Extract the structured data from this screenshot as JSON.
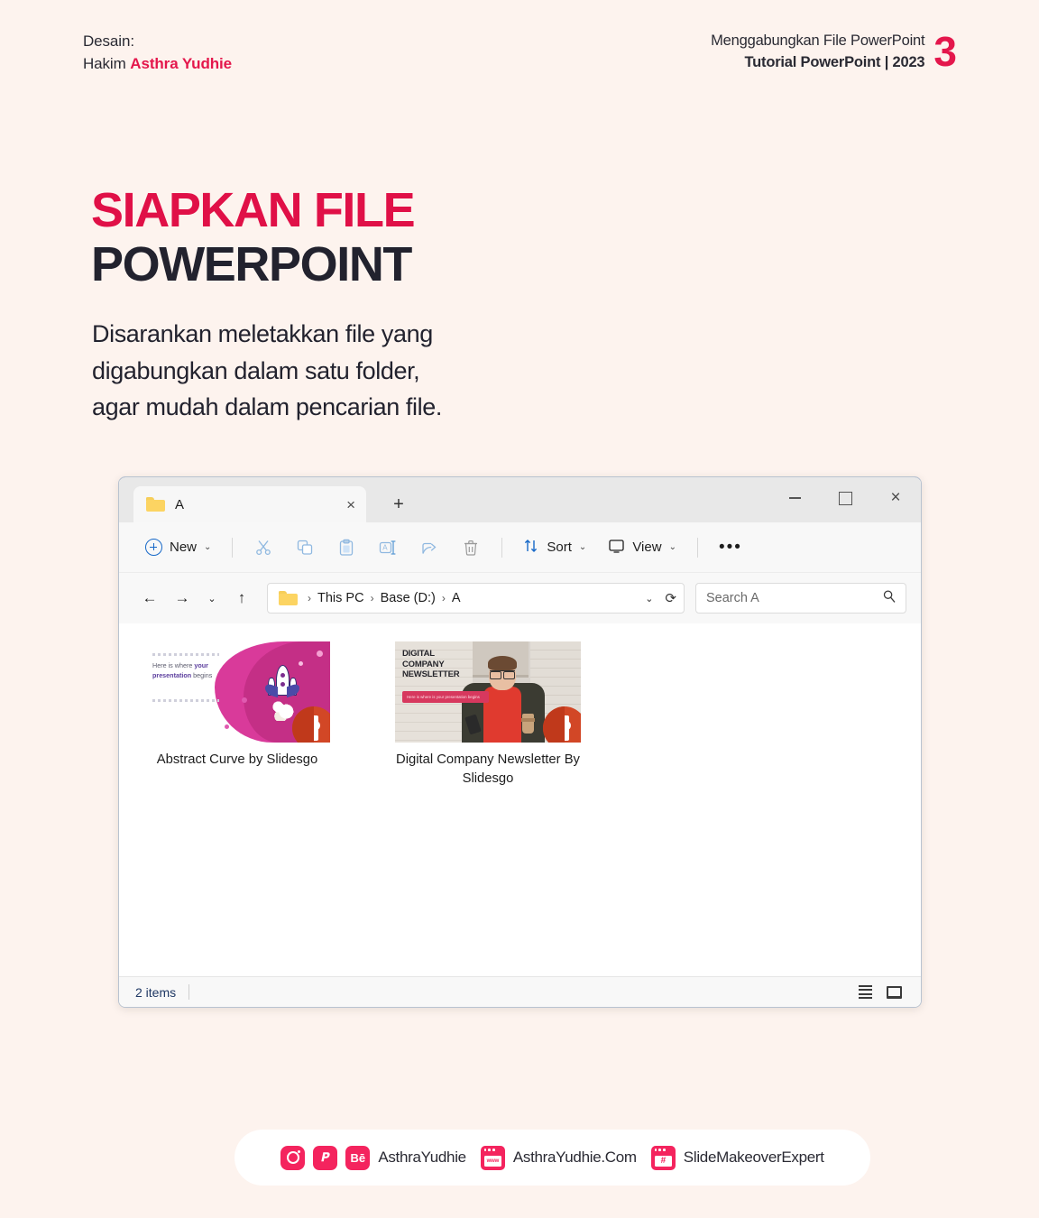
{
  "header": {
    "left_line1": "Desain:",
    "left_line2_prefix": "Hakim ",
    "left_line2_name": "Asthra Yudhie",
    "right_line1": "Menggabungkan File PowerPoint",
    "right_line2": "Tutorial PowerPoint | 2023",
    "slide_number": "3"
  },
  "slide": {
    "title_line1": "SIAPKAN FILE",
    "title_line2": "POWERPOINT",
    "body_line1": "Disarankan meletakkan file yang",
    "body_line2": "digabungkan dalam satu folder,",
    "body_line3": "agar mudah dalam pencarian file."
  },
  "explorer": {
    "tab": {
      "label": "A",
      "close_label": "×",
      "new_tab_label": "+"
    },
    "window_controls": {
      "minimize": "—",
      "maximize": "□",
      "close": "×"
    },
    "toolbar": {
      "new_label": "New",
      "new_chevron": "⌄",
      "sort_label": "Sort",
      "sort_chevron": "⌄",
      "view_label": "View",
      "view_chevron": "⌄",
      "more_label": "•••",
      "icons": [
        "cut-icon",
        "copy-icon",
        "paste-icon",
        "rename-icon",
        "share-icon",
        "delete-icon"
      ]
    },
    "nav": {
      "back": "←",
      "forward": "→",
      "recent_chevron": "⌄",
      "up": "↑",
      "address_chevron": "⌄",
      "refresh": "⟳"
    },
    "breadcrumb": {
      "sep": "›",
      "items": [
        "This PC",
        "Base (D:)",
        "A"
      ]
    },
    "search": {
      "placeholder": "Search A",
      "value": ""
    },
    "files": [
      {
        "name": "Abstract Curve by Slidesgo",
        "badge": "P",
        "thumb_text_1": "Here is where ",
        "thumb_text_b": "your presentation",
        "thumb_text_2": " begins"
      },
      {
        "name": "Digital Company Newsletter By Slidesgo",
        "badge": "P",
        "thumb_title_1": "DIGITAL",
        "thumb_title_2": "COMPANY",
        "thumb_title_3": "NEWSLETTER",
        "thumb_sub": "Here is where is your presentation begins"
      }
    ],
    "status": {
      "items": "2 items",
      "view_details": "details-view-icon",
      "view_large": "large-icons-view-icon"
    }
  },
  "footer": {
    "item1_label": "AsthraYudhie",
    "item2_label": "AsthraYudhie.Com",
    "item3_label": "SlideMakeoverExpert",
    "behance_label": "Bē",
    "pinterest_label": "𝑷",
    "www_label": "www",
    "hash_label": "#"
  },
  "colors": {
    "background": "#fdf3ee",
    "accent_pink": "#e4174c",
    "title_pink": "#e01047",
    "title_dark": "#22222e",
    "footer_pink": "#f4245e"
  }
}
